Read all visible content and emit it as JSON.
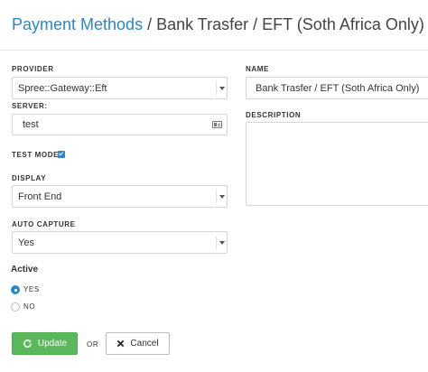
{
  "header": {
    "breadcrumb_link": "Payment Methods",
    "separator": " / ",
    "current_page": "Bank Trasfer / EFT (Soth Africa Only)"
  },
  "form": {
    "provider": {
      "label": "PROVIDER",
      "value": "Spree::Gateway::Eft"
    },
    "server": {
      "label": "SERVER:",
      "value": "test"
    },
    "test_mode": {
      "label": "TEST MODE:",
      "checked": true
    },
    "display": {
      "label": "DISPLAY",
      "value": "Front End"
    },
    "auto_capture": {
      "label": "AUTO CAPTURE",
      "value": "Yes"
    },
    "active": {
      "title": "Active",
      "options": [
        {
          "label": "YES",
          "selected": true
        },
        {
          "label": "NO",
          "selected": false
        }
      ]
    },
    "name": {
      "label": "NAME",
      "value": "Bank Trasfer / EFT (Soth Africa Only)"
    },
    "description": {
      "label": "DESCRIPTION",
      "value": ""
    }
  },
  "actions": {
    "update_label": "Update",
    "or_label": "OR",
    "cancel_label": "Cancel"
  },
  "colors": {
    "link": "#2a87c9",
    "accent": "#2a87c9",
    "update_button": "#5cb85c"
  },
  "icons": {
    "server_field": "card-icon",
    "update_button": "refresh-icon",
    "cancel_button": "close-icon"
  }
}
